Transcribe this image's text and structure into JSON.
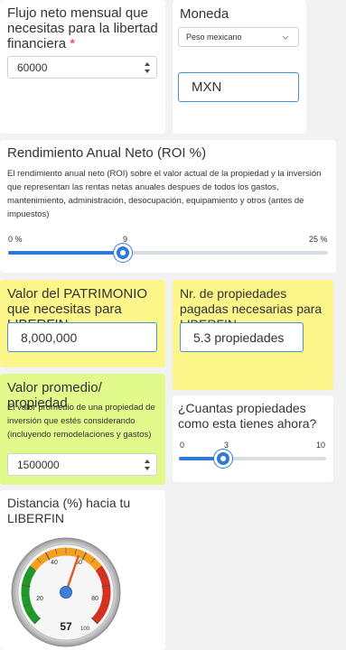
{
  "flujo": {
    "title": "Flujo neto mensual que necesitas para la libertad financiera",
    "required_mark": "*",
    "value": "60000"
  },
  "moneda": {
    "title": "Moneda",
    "selected": "Peso mexicano",
    "code": "MXN"
  },
  "roi": {
    "title": "Rendimiento Anual Neto (ROI %)",
    "description": "El rendimiento anual neto (ROI) sobre el valor actual de la propiedad y la inversión que representan las rentas netas anuales despues de todos los gastos, mantenimiento, administración, desocupación, equipamiento y otros (antes de impuestos)",
    "min_label": "0 %",
    "value_label": "9",
    "max_label": "25 %",
    "fraction": 0.36
  },
  "patrimonio": {
    "title": "Valor del PATRIMONIO que necesitas para LIBERFIN",
    "value": "8,000,000"
  },
  "propiedades_pagadas": {
    "title": "Nr. de propiedades pagadas necesarias para LIBERFIN",
    "value": "5.3 propiedades"
  },
  "valor_promedio": {
    "title": "Valor promedio/ propiedad",
    "description": "El valor promedio de una propiedad de inversión que estés considerando (incluyendo remodelaciones y gastos)",
    "value": "1500000"
  },
  "propiedades_actuales": {
    "title": "¿Cuantas propiedades como esta tienes ahora?",
    "min_label": "0",
    "value_label": "3",
    "max_label": "10",
    "fraction": 0.3
  },
  "distancia": {
    "title": "Distancia (%) hacia tu LIBERFIN",
    "value": "57",
    "gauge_value": 57,
    "scale_labels": [
      "20",
      "40",
      "60",
      "80",
      "100"
    ]
  },
  "colors": {
    "highlight_yellow": "#fcf589",
    "highlight_green": "#e2f98b",
    "accent_blue": "#2e7bd6",
    "gauge_green": "#1f9a2a",
    "gauge_orange": "#f5a020",
    "gauge_red": "#d9301e"
  }
}
